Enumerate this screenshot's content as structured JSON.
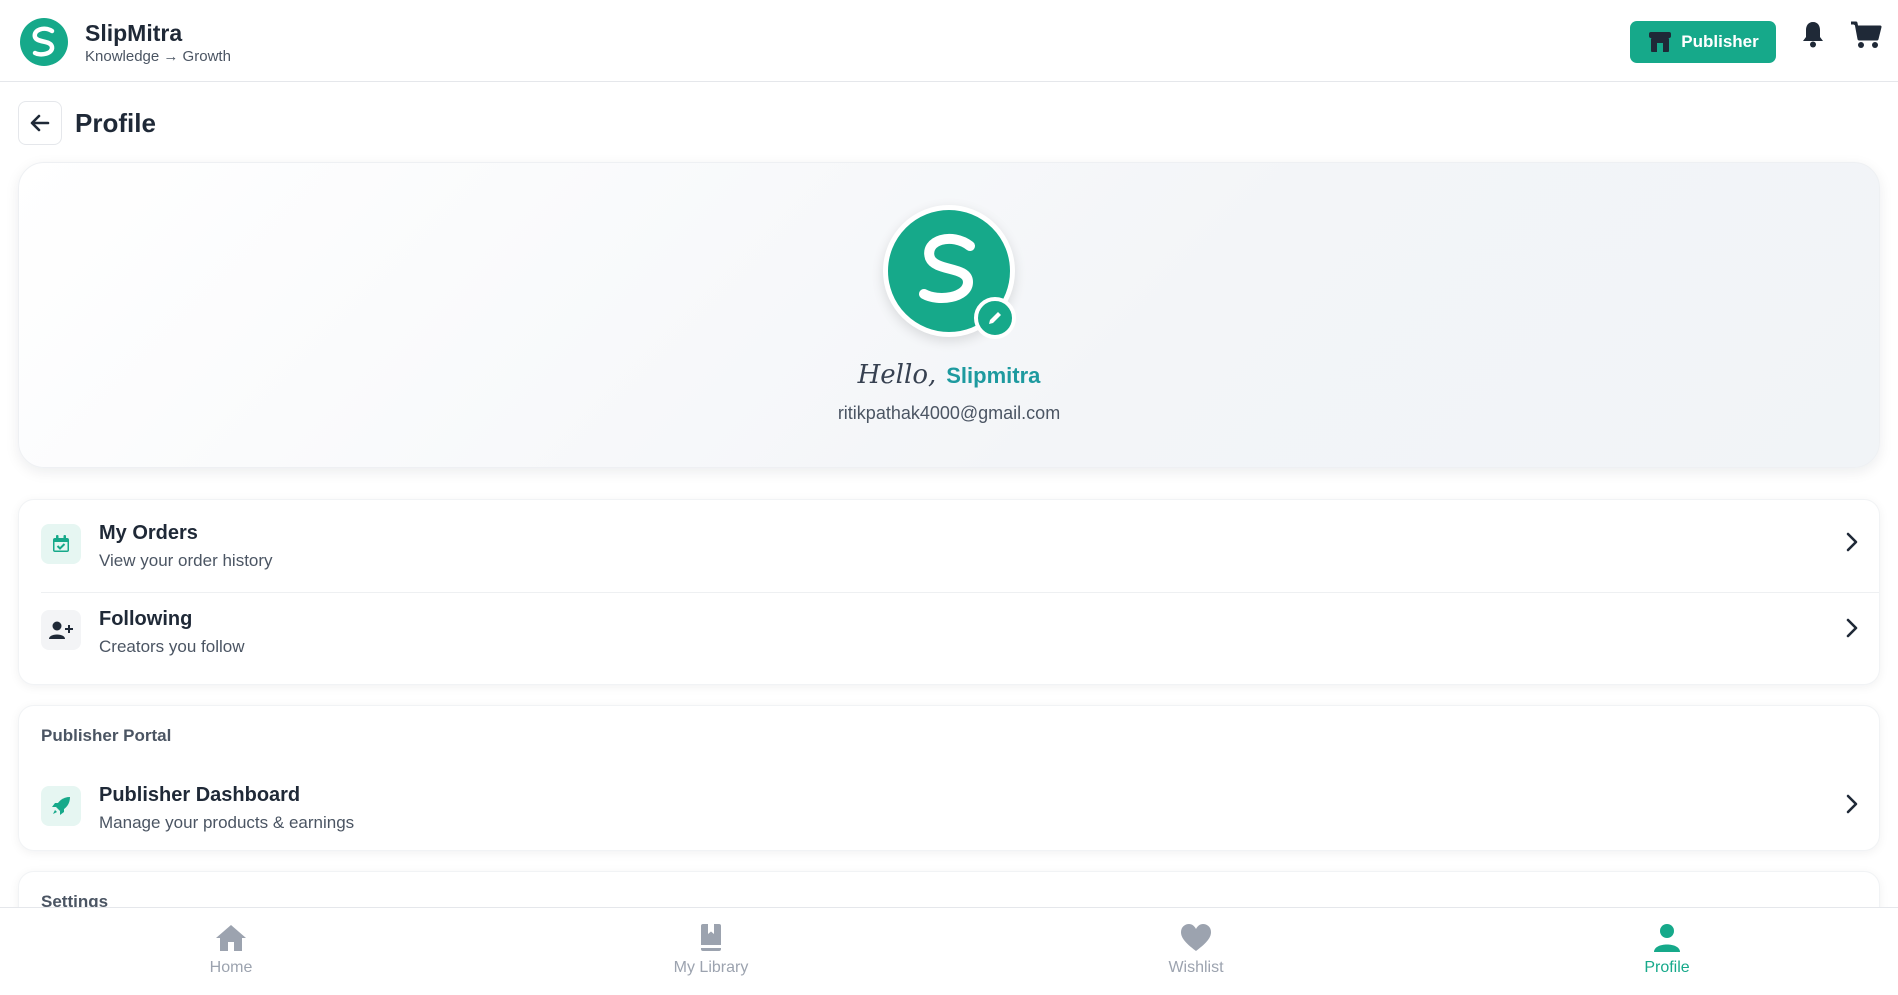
{
  "header": {
    "brand_name": "SlipMitra",
    "tagline": "Knowledge → Growth",
    "publisher_label": "Publisher"
  },
  "page": {
    "title": "Profile"
  },
  "profile": {
    "hello": "Hello,",
    "username": "Slipmitra",
    "email": "ritikpathak4000@gmail.com"
  },
  "menu": {
    "items": [
      {
        "title": "My Orders",
        "subtitle": "View your order history",
        "icon": "calendar-check-icon"
      },
      {
        "title": "Following",
        "subtitle": "Creators you follow",
        "icon": "user-plus-icon"
      }
    ]
  },
  "publisher_portal": {
    "section_label": "Publisher Portal",
    "items": [
      {
        "title": "Publisher Dashboard",
        "subtitle": "Manage your products & earnings",
        "icon": "rocket-icon"
      }
    ]
  },
  "settings": {
    "section_label": "Settings"
  },
  "bottom_nav": {
    "items": [
      {
        "label": "Home",
        "icon": "home-icon",
        "active": false
      },
      {
        "label": "My Library",
        "icon": "book-icon",
        "active": false
      },
      {
        "label": "Wishlist",
        "icon": "heart-icon",
        "active": false
      },
      {
        "label": "Profile",
        "icon": "user-icon",
        "active": true
      }
    ]
  },
  "colors": {
    "accent": "#16a98a",
    "username": "#1d9a9f",
    "inactive_nav": "#9ca3af"
  }
}
